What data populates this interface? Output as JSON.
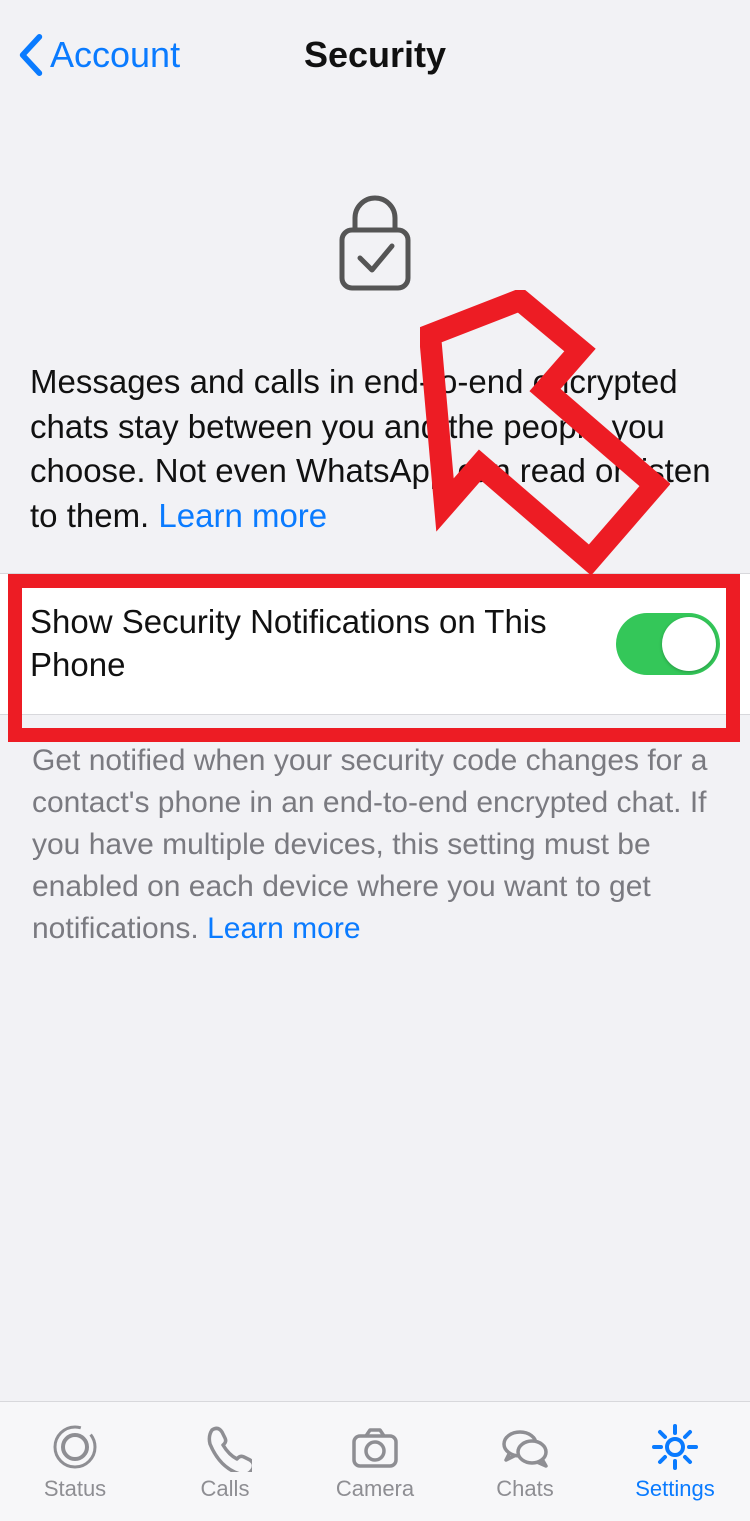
{
  "nav": {
    "back_label": "Account",
    "title": "Security"
  },
  "intro": {
    "text": "Messages and calls in end-to-end encrypted chats stay between you and the people you choose. Not even WhatsApp can read or listen to them. ",
    "learn_more": "Learn more"
  },
  "setting": {
    "label": "Show Security Notifications on This Phone",
    "enabled": true
  },
  "footer": {
    "text": "Get notified when your security code changes for a contact's phone in an end-to-end encrypted chat. If you have multiple devices, this setting must be enabled on each device where you want to get notifications. ",
    "learn_more": "Learn more"
  },
  "tabs": {
    "status": "Status",
    "calls": "Calls",
    "camera": "Camera",
    "chats": "Chats",
    "settings": "Settings"
  },
  "colors": {
    "accent": "#0a7bff",
    "switch_on": "#34c759",
    "annotation": "#ed1c24"
  },
  "annotation": {
    "type": "red-highlight-with-arrow",
    "target": "show-security-notifications-row"
  }
}
